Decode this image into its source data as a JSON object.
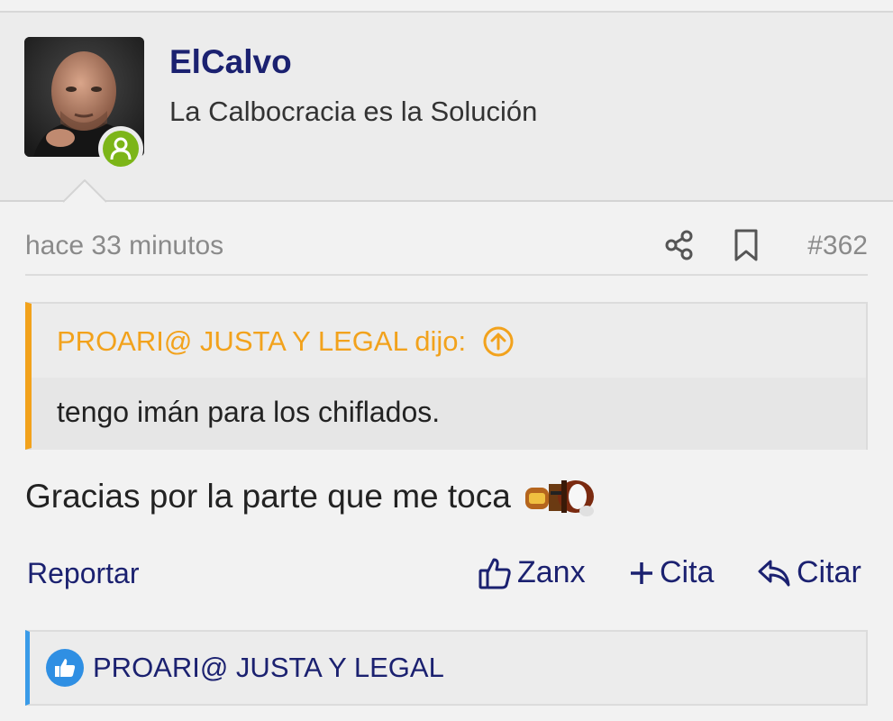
{
  "post": {
    "author": {
      "username": "ElCalvo",
      "title": "La Calbocracia es la Solución",
      "online": true
    },
    "meta": {
      "time": "hace 33 minutos",
      "number": "#362"
    },
    "quote": {
      "header": "PROARI@ JUSTA Y LEGAL dijo:",
      "text": "tengo imán para los chiflados."
    },
    "body": "Gracias por la parte que me toca",
    "actions": {
      "report": "Reportar",
      "like": "Zanx",
      "multiquote": "Cita",
      "reply": "Citar"
    },
    "reactions": {
      "users": "PROARI@ JUSTA Y LEGAL"
    }
  },
  "colors": {
    "accent_link": "#1b2170",
    "quote_border": "#f2a21c",
    "reaction_border": "#3a9be8",
    "online": "#7cb518"
  },
  "icons": [
    "share-icon",
    "bookmark-icon",
    "arrow-up-circle-icon",
    "thumbs-up-icon",
    "plus-icon",
    "reply-icon",
    "like-badge-icon",
    "user-icon"
  ]
}
